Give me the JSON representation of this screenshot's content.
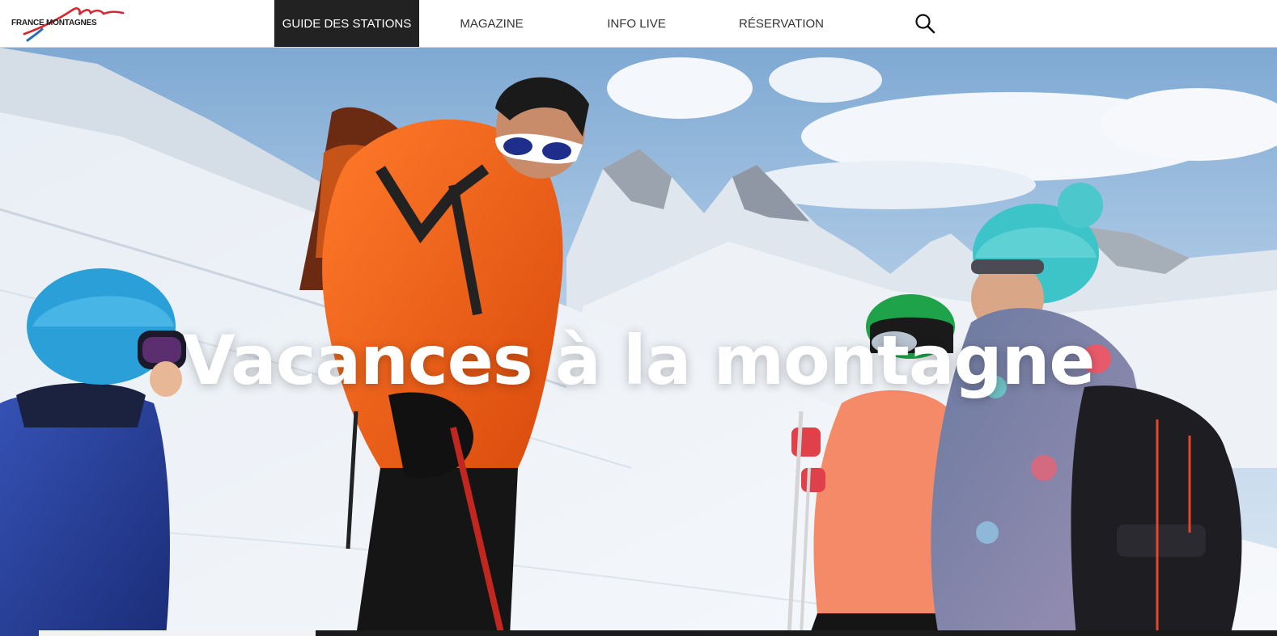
{
  "brand": {
    "logo_text": "FRANCE MONTAGNES",
    "accent_red": "#d7262e",
    "accent_blue": "#1e6fb5"
  },
  "nav": {
    "items": [
      {
        "label": "GUIDE DES STATIONS",
        "active": true
      },
      {
        "label": "MAGAZINE",
        "active": false
      },
      {
        "label": "INFO LIVE",
        "active": false
      },
      {
        "label": "RÉSERVATION",
        "active": false
      }
    ],
    "search_icon": "search-icon"
  },
  "hero": {
    "title": "Vacances à la montagne",
    "image": "family-skiing-mountain-photo"
  }
}
